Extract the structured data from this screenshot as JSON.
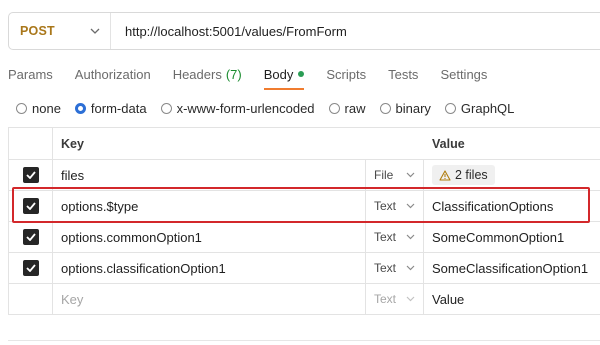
{
  "request": {
    "method": "POST",
    "url": "http://localhost:5001/values/FromForm"
  },
  "tabs": [
    {
      "label": "Params"
    },
    {
      "label": "Authorization"
    },
    {
      "label": "Headers",
      "count": "(7)"
    },
    {
      "label": "Body",
      "active": true
    },
    {
      "label": "Scripts"
    },
    {
      "label": "Tests"
    },
    {
      "label": "Settings"
    }
  ],
  "body_types": [
    {
      "label": "none"
    },
    {
      "label": "form-data",
      "selected": true
    },
    {
      "label": "x-www-form-urlencoded"
    },
    {
      "label": "raw"
    },
    {
      "label": "binary"
    },
    {
      "label": "GraphQL"
    }
  ],
  "table": {
    "headers": {
      "key": "Key",
      "value": "Value"
    },
    "rows": [
      {
        "checked": true,
        "key": "files",
        "type": "File",
        "value": "2 files",
        "value_kind": "files"
      },
      {
        "checked": true,
        "key": "options.$type",
        "type": "Text",
        "value": "ClassificationOptions"
      },
      {
        "checked": true,
        "key": "options.commonOption1",
        "type": "Text",
        "value": "SomeCommonOption1"
      },
      {
        "checked": true,
        "key": "options.classificationOption1",
        "type": "Text",
        "value": "SomeClassificationOption1"
      }
    ],
    "empty_row": {
      "key_placeholder": "Key",
      "type": "Text",
      "value_placeholder": "Value"
    }
  },
  "colors": {
    "method": "#a9771a",
    "active_tab_underline": "#f07c2f",
    "body_dot": "#2a9d54",
    "headers_count": "#1a8c2f",
    "radio_selected": "#2c6fd6",
    "highlight_box": "#d3282b"
  }
}
